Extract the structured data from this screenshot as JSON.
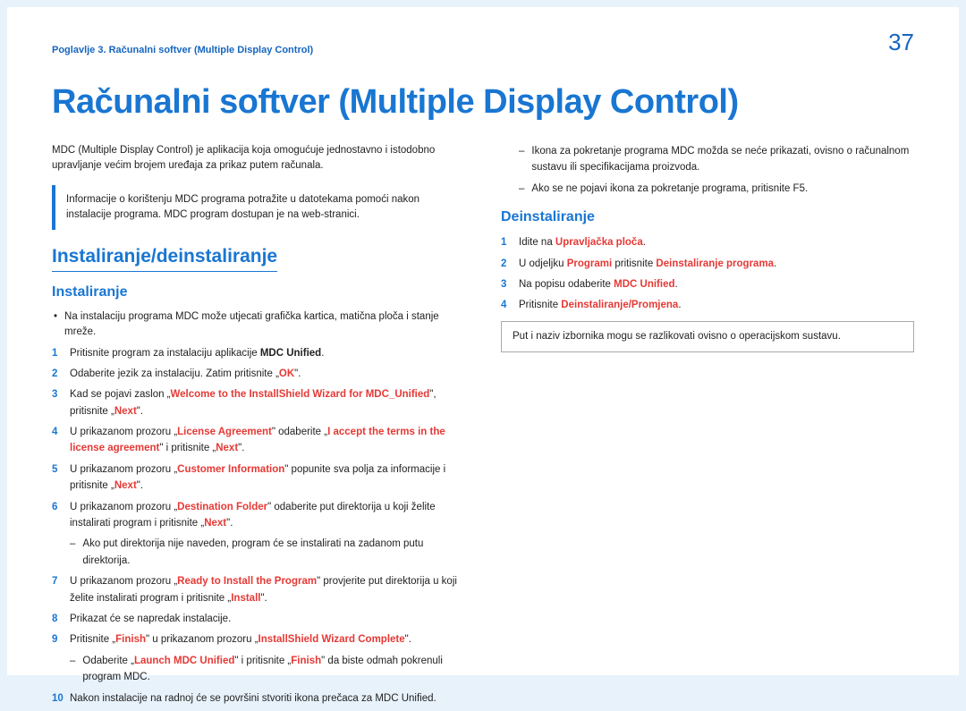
{
  "header": {
    "breadcrumb": "Poglavlje 3. Računalni softver (Multiple Display Control)",
    "pageNumber": "37"
  },
  "title": "Računalni softver (Multiple Display Control)",
  "intro": "MDC (Multiple Display Control) je aplikacija koja omogućuje jednostavno i istodobno upravljanje većim brojem uređaja za prikaz putem računala.",
  "infoBox": "Informacije o korištenju MDC programa potražite u datotekama pomoći nakon instalacije programa. MDC program dostupan je na web-stranici.",
  "section1": {
    "heading": "Instaliranje/deinstaliranje",
    "sub1": {
      "heading": "Instaliranje",
      "bullet": "Na instalaciju programa MDC može utjecati grafička kartica, matična ploča i stanje mreže.",
      "steps": {
        "s1_a": "Pritisnite program za instalaciju aplikacije ",
        "s1_b": "MDC Unified",
        "s1_c": ".",
        "s2_a": "Odaberite jezik za instalaciju. Zatim pritisnite „",
        "s2_b": "OK",
        "s2_c": "\".",
        "s3_a": "Kad se pojavi zaslon „",
        "s3_b": "Welcome to the InstallShield Wizard for MDC_Unified",
        "s3_c": "\", pritisnite „",
        "s3_d": "Next",
        "s3_e": "\".",
        "s4_a": "U prikazanom prozoru „",
        "s4_b": "License Agreement",
        "s4_c": "\" odaberite „",
        "s4_d": "I accept the terms in the license agreement",
        "s4_e": "\" i pritisnite „",
        "s4_f": "Next",
        "s4_g": "\".",
        "s5_a": "U prikazanom prozoru „",
        "s5_b": "Customer Information",
        "s5_c": "\" popunite sva polja za informacije i pritisnite „",
        "s5_d": "Next",
        "s5_e": "\".",
        "s6_a": "U prikazanom prozoru „",
        "s6_b": "Destination Folder",
        "s6_c": "\" odaberite put direktorija u koji želite instalirati program i pritisnite „",
        "s6_d": "Next",
        "s6_e": "\".",
        "s6_sub": "Ako put direktorija nije naveden, program će se instalirati na zadanom putu direktorija.",
        "s7_a": "U prikazanom prozoru „",
        "s7_b": "Ready to Install the Program",
        "s7_c": "\" provjerite put direktorija u koji želite instalirati program i pritisnite „",
        "s7_d": "Install",
        "s7_e": "\".",
        "s8": "Prikazat će se napredak instalacije.",
        "s9_a": "Pritisnite „",
        "s9_b": "Finish",
        "s9_c": "\" u prikazanom prozoru „",
        "s9_d": "InstallShield Wizard Complete",
        "s9_e": "\".",
        "s9_sub_a": "Odaberite „",
        "s9_sub_b": "Launch MDC Unified",
        "s9_sub_c": "\" i pritisnite „",
        "s9_sub_d": "Finish",
        "s9_sub_e": "\" da biste odmah pokrenuli program MDC.",
        "s10": "Nakon instalacije na radnoj će se površini stvoriti ikona prečaca za MDC Unified."
      }
    }
  },
  "rightCol": {
    "sub1": "Ikona za pokretanje programa MDC možda se neće prikazati, ovisno o računalnom sustavu ili specifikacijama proizvoda.",
    "sub2": "Ako se ne pojavi ikona za pokretanje programa, pritisnite F5.",
    "heading": "Deinstaliranje",
    "steps": {
      "s1_a": "Idite na ",
      "s1_b": "Upravljačka ploča",
      "s1_c": ".",
      "s2_a": "U odjeljku ",
      "s2_b": "Programi",
      "s2_c": " pritisnite ",
      "s2_d": "Deinstaliranje programa",
      "s2_e": ".",
      "s3_a": "Na popisu odaberite ",
      "s3_b": "MDC Unified",
      "s3_c": ".",
      "s4_a": "Pritisnite ",
      "s4_b": "Deinstaliranje/Promjena",
      "s4_c": "."
    },
    "note": "Put i naziv izbornika mogu se razlikovati ovisno o operacijskom sustavu."
  }
}
